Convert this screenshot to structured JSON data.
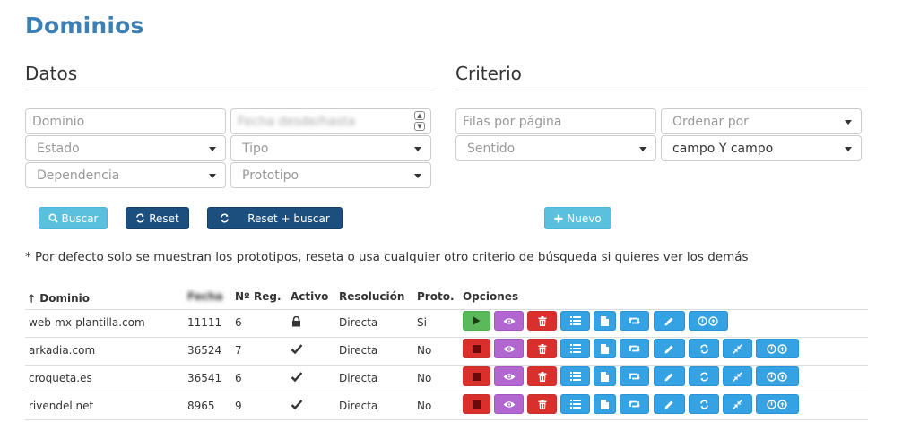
{
  "page": {
    "title": "Dominios"
  },
  "datos": {
    "title": "Datos",
    "dominio_placeholder": "Dominio",
    "fecha_placeholder": "Fecha desde/hasta",
    "estado": "Estado",
    "tipo": "Tipo",
    "dependencia": "Dependencia",
    "prototipo": "Prototipo"
  },
  "criterio": {
    "title": "Criterio",
    "filas_placeholder": "Filas por página",
    "ordenar": "Ordenar por",
    "sentido": "Sentido",
    "campo": "campo Y campo"
  },
  "buttons": {
    "buscar": "Buscar",
    "reset": "Reset",
    "reset_buscar": "Reset + buscar",
    "nuevo": "Nuevo"
  },
  "note": "* Por defecto solo se muestran los prototipos, reseta o usa cualquier otro criterio de búsqueda si quieres ver los demás",
  "table": {
    "headers": {
      "dominio": "Dominio",
      "fecha": "Fecha",
      "nreg": "Nº Reg.",
      "activo": "Activo",
      "resolucion": "Resolución",
      "proto": "Proto.",
      "opciones": "Opciones"
    },
    "rows": [
      {
        "dominio": "web-mx-plantilla.com",
        "fecha": "11111",
        "nreg": "6",
        "activo": "lock-icon",
        "resolucion": "Directa",
        "proto": "Si"
      },
      {
        "dominio": "arkadia.com",
        "fecha": "36524",
        "nreg": "7",
        "activo": "check-icon",
        "resolucion": "Directa",
        "proto": "No"
      },
      {
        "dominio": "croqueta.es",
        "fecha": "36541",
        "nreg": "6",
        "activo": "check-icon",
        "resolucion": "Directa",
        "proto": "No"
      },
      {
        "dominio": "rivendel.net",
        "fecha": "8965",
        "nreg": "9",
        "activo": "check-icon",
        "resolucion": "Directa",
        "proto": "No"
      }
    ]
  },
  "colors": {
    "title": "#3a7fb5",
    "info": "#5bc0de",
    "primary": "#1c4f7e",
    "green": "#5cb85c",
    "red": "#d9302e",
    "purple": "#b267d0",
    "blue": "#35a2e4"
  }
}
